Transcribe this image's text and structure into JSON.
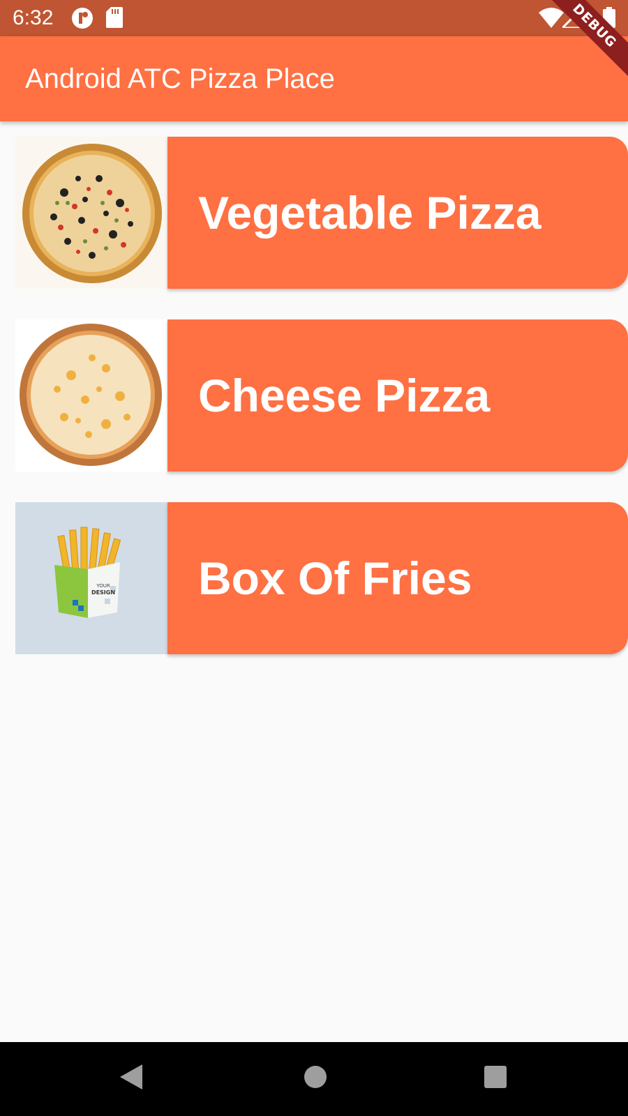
{
  "status_bar": {
    "time": "6:32",
    "icons": [
      "cloud-sync-icon",
      "sd-card-icon",
      "wifi-icon",
      "signal-icon",
      "battery-icon"
    ]
  },
  "debug_banner": "DEBUG",
  "app_bar": {
    "title": "Android ATC Pizza Place",
    "color": "#ff7043"
  },
  "menu": {
    "items": [
      {
        "label": "Vegetable Pizza",
        "image": "vegetable-pizza-image"
      },
      {
        "label": "Cheese Pizza",
        "image": "cheese-pizza-image"
      },
      {
        "label": "Box Of Fries",
        "image": "fries-box-image",
        "box_text": [
          "YOUR",
          "DESIGN"
        ]
      }
    ]
  },
  "nav_bar": {
    "buttons": [
      "back-icon",
      "home-icon",
      "recents-icon"
    ]
  },
  "colors": {
    "status_bar": "#bf5532",
    "accent": "#ff7043",
    "background": "#fafafa",
    "debug": "#8e1f1f"
  }
}
